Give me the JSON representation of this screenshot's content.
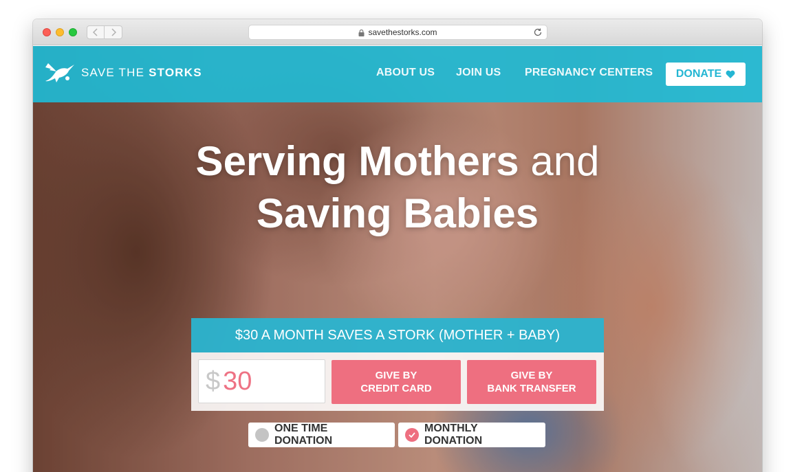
{
  "browser": {
    "url": "savethestorks.com"
  },
  "header": {
    "logo_light": "SAVE THE",
    "logo_bold": "STORKS",
    "nav": [
      "ABOUT US",
      "JOIN US",
      "PREGNANCY CENTERS"
    ],
    "donate_label": "DONATE"
  },
  "hero": {
    "line1_bold": "Serving Mothers",
    "line1_light": "and",
    "line2": "Saving Babies"
  },
  "donation": {
    "banner": "$30 A MONTH SAVES A STORK (MOTHER + BABY)",
    "currency": "$",
    "amount": "30",
    "credit_line1": "GIVE BY",
    "credit_line2": "CREDIT CARD",
    "bank_line1": "GIVE BY",
    "bank_line2": "BANK TRANSFER",
    "one_time": "ONE TIME DONATION",
    "monthly": "MONTHLY DONATION",
    "selected": "monthly"
  },
  "colors": {
    "header_blue": "#20bad4",
    "accent_pink": "#ee6f80"
  }
}
